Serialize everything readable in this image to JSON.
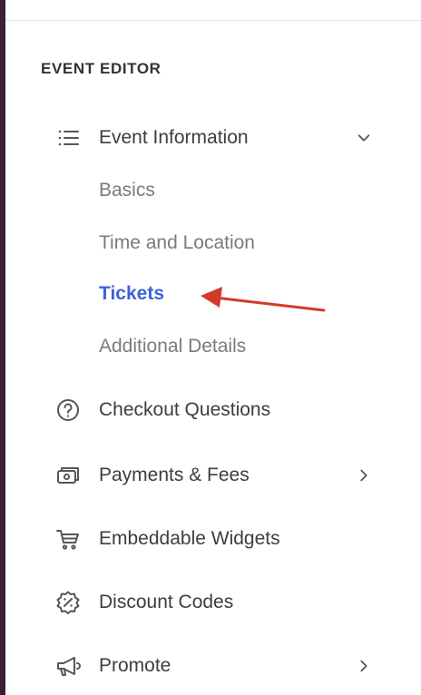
{
  "sidebar": {
    "section_title": "EVENT EDITOR",
    "items": [
      {
        "label": "Event Information",
        "icon": "list-icon",
        "chevron": "down",
        "subitems": [
          {
            "label": "Basics",
            "active": false
          },
          {
            "label": "Time and Location",
            "active": false
          },
          {
            "label": "Tickets",
            "active": true
          },
          {
            "label": "Additional Details",
            "active": false
          }
        ]
      },
      {
        "label": "Checkout Questions",
        "icon": "question-circle-icon"
      },
      {
        "label": "Payments & Fees",
        "icon": "money-icon",
        "chevron": "right"
      },
      {
        "label": "Embeddable Widgets",
        "icon": "cart-icon"
      },
      {
        "label": "Discount Codes",
        "icon": "percent-badge-icon"
      },
      {
        "label": "Promote",
        "icon": "megaphone-icon",
        "chevron": "right"
      }
    ]
  },
  "colors": {
    "active_link": "#3b63d6",
    "annotation_arrow": "#d23a2a",
    "left_edge": "#3a1f3a"
  }
}
